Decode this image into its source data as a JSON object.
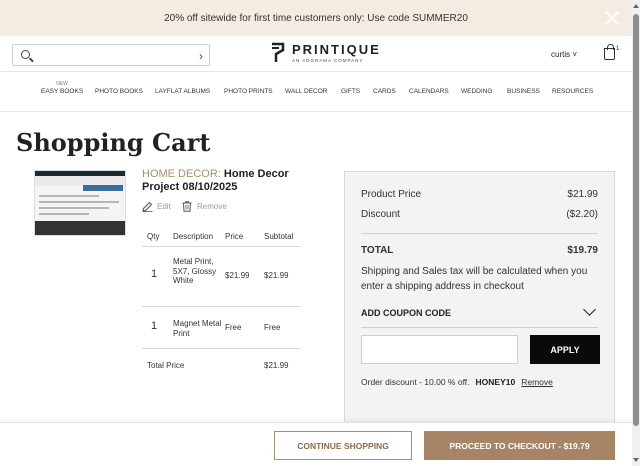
{
  "promo": {
    "text": "20% off sitewide for first time customers only: Use code SUMMER20"
  },
  "header": {
    "search_placeholder": "",
    "search_go": "›",
    "logo_name": "PRINTIQUE",
    "logo_sub": "AN ADORAMA COMPANY",
    "account": "curtis ˅",
    "cart_count": "1"
  },
  "nav": {
    "new_badge": "NEW",
    "items": [
      "EASY BOOKS",
      "PHOTO BOOKS",
      "LAYFLAT ALBUMS",
      "PHOTO PRINTS",
      "WALL DECOR",
      "GIFTS",
      "CARDS",
      "CALENDARS",
      "WEDDING",
      "BUSINESS",
      "RESOURCES"
    ]
  },
  "page": {
    "title": "Shopping Cart"
  },
  "item": {
    "category": "HOME DECOR:",
    "name": "Home Decor Project 08/10/2025",
    "edit": "Edit",
    "remove": "Remove",
    "columns": [
      "Qty",
      "Description",
      "Price",
      "Subtotal"
    ],
    "rows": [
      {
        "qty": "1",
        "desc": "Metal Print, 5X7, Glossy White",
        "price": "$21.99",
        "subtotal": "$21.99"
      },
      {
        "qty": "1",
        "desc": "Magnet Metal Print",
        "price": "Free",
        "subtotal": "Free"
      }
    ],
    "total_label": "Total Price",
    "total_value": "$21.99"
  },
  "summary": {
    "product_price_label": "Product Price",
    "product_price": "$21.99",
    "discount_label": "Discount",
    "discount": "($2.20)",
    "total_label": "TOTAL",
    "total": "$19.79",
    "ship_note": "Shipping and Sales tax will be calculated when you enter a shipping address in checkout",
    "coupon_label": "ADD COUPON CODE",
    "coupon_value": "",
    "apply": "APPLY",
    "order_discount": "Order discount - 10.00 % off.",
    "code": "HONEY10",
    "code_remove": "Remove"
  },
  "footer": {
    "continue": "CONTINUE SHOPPING",
    "checkout": "PROCEED TO CHECKOUT - $19.79"
  },
  "colors": {
    "accent": "#a88466",
    "promo_bg": "#f3ece2",
    "category": "#a88f6a"
  }
}
